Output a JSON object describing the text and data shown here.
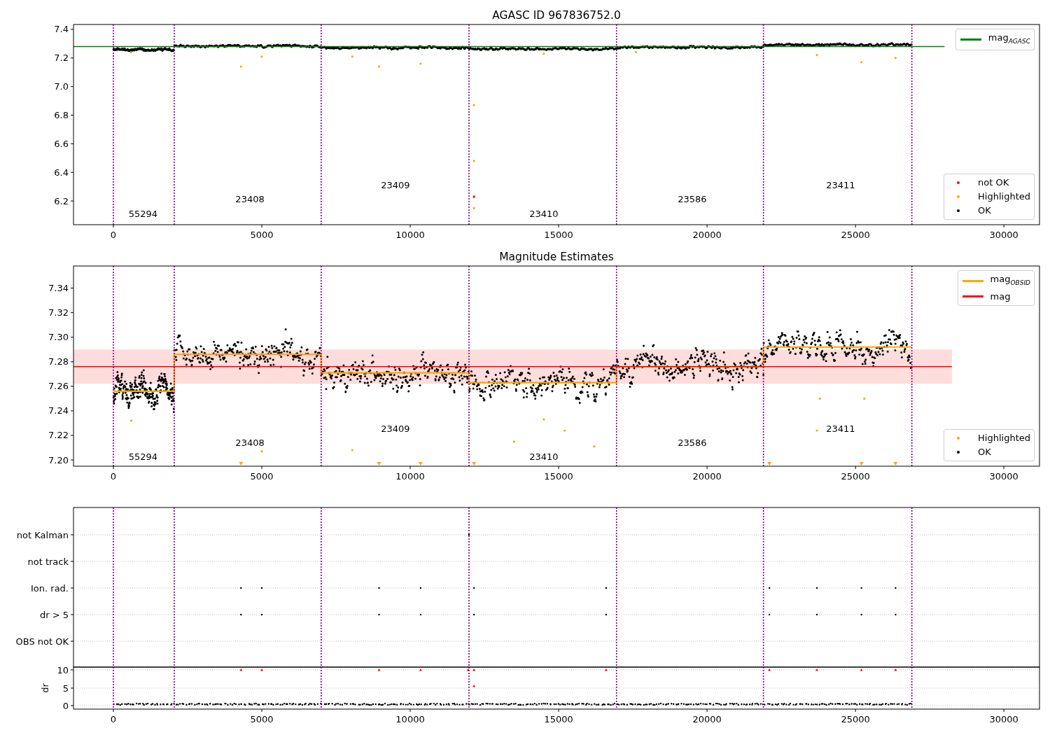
{
  "panels": [
    {
      "kind": "magnitude",
      "title": "AGASC ID 967836752.0",
      "chart_data": {
        "type": "line",
        "x": [
          -1344,
          28000
        ],
        "xlim": [
          -1344,
          31200
        ],
        "ylim": [
          6.034,
          7.434
        ],
        "xticks": [
          0,
          5000,
          10000,
          15000,
          20000,
          25000,
          30000
        ],
        "yticks": [
          {
            "value": 6.2,
            "label": "6.2"
          },
          {
            "value": 6.4,
            "label": "6.4"
          },
          {
            "value": 6.6,
            "label": "6.6"
          },
          {
            "value": 6.8,
            "label": "6.8"
          },
          {
            "value": 7.0,
            "label": "7.0"
          },
          {
            "value": 7.2,
            "label": "7.2"
          },
          {
            "value": 7.4,
            "label": "7.4"
          }
        ],
        "series": [
          {
            "name": "mag$_{AGASC}$",
            "color": "#008000",
            "values": [
              7.28,
              7.28
            ]
          }
        ],
        "annotations": [
          "55294",
          "23408",
          "23409",
          "23410",
          "23586",
          "23411"
        ]
      },
      "legend_markers": [
        {
          "label": "not OK",
          "color": "#ff0000"
        },
        {
          "label": "Highlighted",
          "color": "#ffa500"
        },
        {
          "label": "OK",
          "color": "#000000"
        }
      ]
    },
    {
      "kind": "magnitude",
      "title": "Magnitude Estimates",
      "chart_data": {
        "type": "line",
        "x": [
          -1344,
          0,
          2050,
          2050,
          7000,
          7000,
          11980,
          11980,
          16950,
          16950,
          21900,
          21900,
          26900,
          28250
        ],
        "xlim": [
          -1344,
          31200
        ],
        "ylim": [
          7.1949,
          7.358
        ],
        "xticks": [
          0,
          5000,
          10000,
          15000,
          20000,
          25000,
          30000
        ],
        "yticks": [
          {
            "value": 7.2,
            "label": "7.20"
          },
          {
            "value": 7.22,
            "label": "7.22"
          },
          {
            "value": 7.24,
            "label": "7.24"
          },
          {
            "value": 7.26,
            "label": "7.26"
          },
          {
            "value": 7.28,
            "label": "7.28"
          },
          {
            "value": 7.3,
            "label": "7.30"
          },
          {
            "value": 7.32,
            "label": "7.32"
          },
          {
            "value": 7.34,
            "label": "7.34"
          }
        ],
        "series": [
          {
            "name": "mag$_{OBSID}$",
            "color": "#ffa500",
            "values": [
              null,
              7.256,
              7.256,
              7.286,
              7.286,
              7.271,
              7.271,
              7.263,
              7.263,
              7.276,
              7.276,
              7.292,
              7.292,
              null
            ]
          },
          {
            "name": "mag",
            "color": "#ff0000",
            "values": [
              7.276,
              7.276,
              7.276,
              7.276,
              7.276,
              7.276,
              7.276,
              7.276,
              7.276,
              7.276,
              7.276,
              7.276,
              7.276,
              7.276
            ]
          }
        ],
        "annotations": [
          "55294",
          "23408",
          "23409",
          "23410",
          "23586",
          "23411"
        ]
      },
      "legend_markers": [
        {
          "label": "Highlighted",
          "color": "#ffa500"
        },
        {
          "label": "OK",
          "color": "#000000"
        }
      ]
    },
    {
      "kind": "flags",
      "rows": [
        "not Kalman",
        "not track",
        "Ion. rad.",
        "dr > 5",
        "OBS not OK"
      ]
    },
    {
      "kind": "dr",
      "ylabel": "dr",
      "yticks": [
        "10",
        "5",
        "0"
      ],
      "xticks": [
        "0",
        "5000",
        "10000",
        "15000",
        "20000",
        "25000",
        "30000"
      ]
    }
  ]
}
